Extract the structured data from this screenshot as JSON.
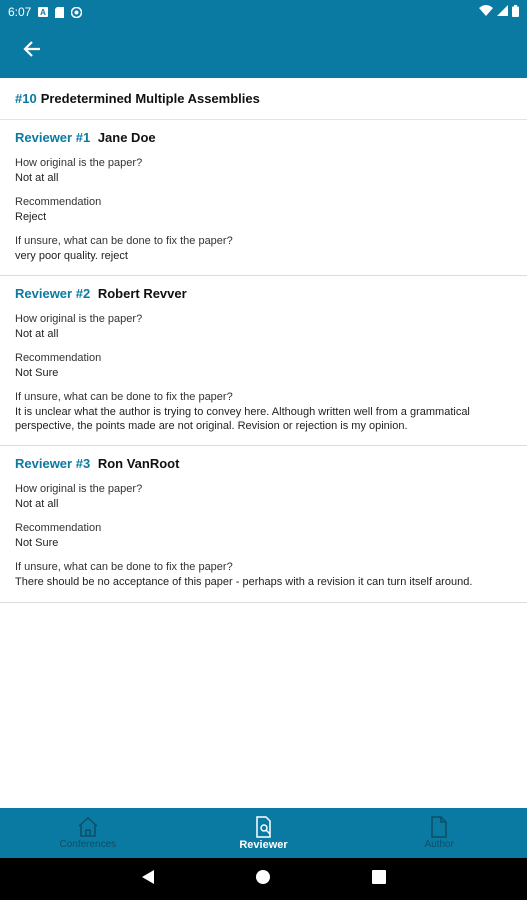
{
  "status_bar": {
    "time": "6:07",
    "left_icons": [
      "a-icon",
      "sd-card-icon",
      "vpn-icon"
    ],
    "right_icons": [
      "wifi-icon",
      "signal-icon",
      "battery-icon"
    ]
  },
  "app_bar": {
    "back_icon": "arrow-left-icon"
  },
  "paper": {
    "number": "#10",
    "title": "Predetermined Multiple Assemblies"
  },
  "reviews": [
    {
      "label": "Reviewer",
      "number": "#1",
      "name": "Jane Doe",
      "q1": "How original is the paper?",
      "a1": "Not at all",
      "q2": "Recommendation",
      "a2": "Reject",
      "q3": "If unsure, what can be done to fix the paper?",
      "a3": "very poor quality.  reject"
    },
    {
      "label": "Reviewer",
      "number": "#2",
      "name": "Robert Revver",
      "q1": "How original is the paper?",
      "a1": "Not at all",
      "q2": "Recommendation",
      "a2": "Not Sure",
      "q3": "If unsure, what can be done to fix the paper?",
      "a3": "It is unclear what the author is trying to convey here.  Although written well from a grammatical perspective, the points made are not original.  Revision or rejection is my opinion."
    },
    {
      "label": "Reviewer",
      "number": "#3",
      "name": "Ron VanRoot",
      "q1": "How original is the paper?",
      "a1": "Not at all",
      "q2": "Recommendation",
      "a2": "Not Sure",
      "q3": "If unsure, what can be done to fix the paper?",
      "a3": "There should be no acceptance of this paper - perhaps with a revision it can turn itself around."
    }
  ],
  "bottom_nav": {
    "items": [
      {
        "label": "Conferences",
        "icon": "home-icon",
        "active": false
      },
      {
        "label": "Reviewer",
        "icon": "document-search-icon",
        "active": true
      },
      {
        "label": "Author",
        "icon": "document-icon",
        "active": false
      }
    ]
  },
  "colors": {
    "primary": "#0a7aa3",
    "inactive_nav_label": "#0d4e68"
  }
}
